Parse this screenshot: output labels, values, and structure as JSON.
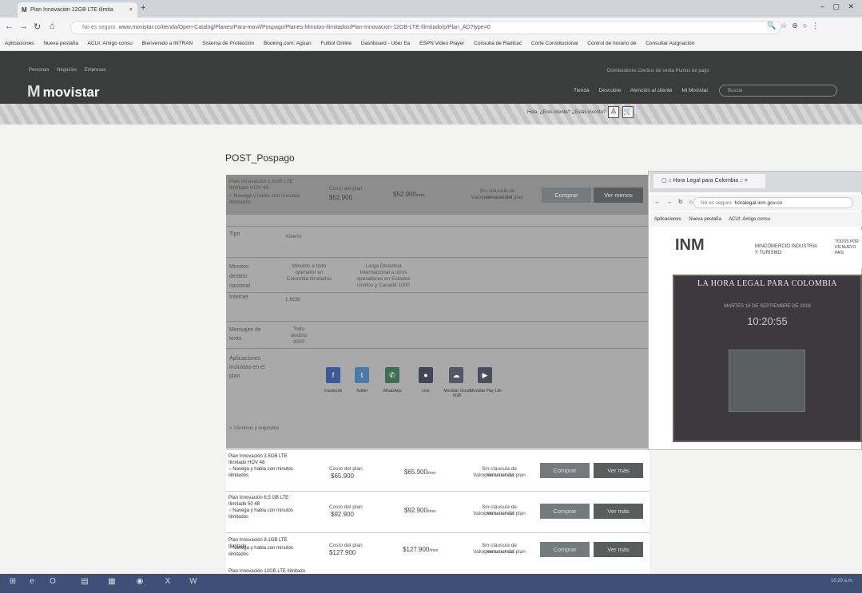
{
  "browser": {
    "tab_title": "Plan Innovación 12GB LTE ilimita",
    "tab_close": "×",
    "newtab": "+",
    "url_prefix": "No es seguro",
    "url": "www.movistar.co/tienda/Open-Catalog/Planes/Para-movil/Pospago/Planes-Minutos-Ilimitados/Plan-Innovacion-12GB-LTE-Ilimitado/p/Plan_AD?type=0",
    "bookmarks": [
      "Aplicaciones",
      "Nueva pestaña",
      "ACUI: Amigo consu",
      "Bienvenido a INTRAN",
      "Sistema de Protección",
      "Booking.com: Agoan",
      "Futbol Online",
      "Dashboard - Uber Ea",
      "ESPN Video Player",
      "Consulta de Radicac",
      "Corte Constitucional",
      "Control de horario de",
      "Consultar Asignación"
    ]
  },
  "site": {
    "segments": [
      "Personas",
      "Negocios",
      "Empresas"
    ],
    "logo": "movistar",
    "toplinks": "Distribuidores  Centros de venta  Puntos de pago",
    "nav": [
      "Tienda",
      "Descubre",
      "Atención al cliente",
      "Mi Movistar"
    ],
    "search_placeholder": "Buscar",
    "userlinks": "Hola, ¿Eres cliente?  ¿Estás inscrito?"
  },
  "page": {
    "title": "POST_Pospago",
    "expanded_plan": {
      "name": "Plan Innovación 1.6GB LTE Ilimitado HOV 48",
      "feature": "Navega y habla con minutos ilimitados",
      "cost_label": "Costo del plan",
      "cost": "$52.900",
      "price": "$52.900",
      "price_unit": "/mes",
      "perm_label": "Sin cláusula de permanencia",
      "perm_sub": "Valor mensual del plan",
      "buy": "Comprar",
      "less": "Ver menos",
      "rows": [
        {
          "label": "Tipo",
          "value": "Abierto"
        },
        {
          "label": "Minutos destino nacional",
          "value": "Minutos a todo operador en Colombia Ilimitados",
          "value2": "Larga Distancia Internacional a otros operadores en Estados Unidos y Canadá 1000"
        },
        {
          "label": "Internet",
          "value": "1.6GB"
        },
        {
          "label": "Mensajes de texto",
          "value": "Todo destino 3000"
        },
        {
          "label": "Aplicaciones incluidas en el plan",
          "value": ""
        }
      ],
      "apps": [
        "Facebook",
        "Twitter",
        "WhatsApp",
        "Line",
        "Movistar Cloud 5GB",
        "Movistar Play Lite"
      ],
      "more_link": "> Términos y requisitos"
    },
    "plans": [
      {
        "name": "Plan Innovación 3.5GB LTE Ilimitado HOV 48",
        "feature": "Navega y habla con minutos ilimitados",
        "cost_label": "Costo del plan",
        "cost": "$65.900",
        "price": "$65.900",
        "unit": "/mes",
        "perm": "Sin cláusula de permanencia",
        "perm_sub": "Valor mensual del plan",
        "buy": "Comprar",
        "more": "Ver más"
      },
      {
        "name": "Plan Innovación 6.5 GB LTE Ilimitado 50 48",
        "feature": "Navega y habla con minutos ilimitados",
        "cost_label": "Costo del plan",
        "cost": "$92.900",
        "price": "$92.900",
        "unit": "/mes",
        "perm": "Sin cláusula de permanencia",
        "perm_sub": "Valor mensual del plan",
        "buy": "Comprar",
        "more": "Ver más"
      },
      {
        "name": "Plan Innovación 8.1GB LTE Ilimitado",
        "feature": "Navega y habla con minutos ilimitados",
        "cost_label": "Costo del plan",
        "cost": "$127.900",
        "price": "$127.900",
        "unit": "/mes",
        "perm": "Sin cláusula de permanencia",
        "perm_sub": "Valor mensual del plan",
        "buy": "Comprar",
        "more": "Ver más"
      }
    ],
    "next_plan_name": "Plan Innovación 12GB LTE Ilimitado"
  },
  "popup": {
    "tab_title": ":: Hora Legal para Colombia ::",
    "url_prefix": "No es seguro",
    "url": "horalegal.inm.gov.co",
    "bookmarks": [
      "Aplicaciones",
      "Nueva pestaña",
      "ACUI: Amigo consu"
    ],
    "inm": "INM",
    "mincomercio": "MINCOMERCIO INDUSTRIA Y TURISMO",
    "todos": "TODOS POR UN NUEVO PAÍS",
    "banner_title": "LA HORA LEGAL PARA COLOMBIA",
    "date": "MARTES 18 DE SEPTIEMBRE DE 2018",
    "clock": "10:20:55"
  },
  "taskbar": {
    "clock": "10:20 a.m."
  }
}
